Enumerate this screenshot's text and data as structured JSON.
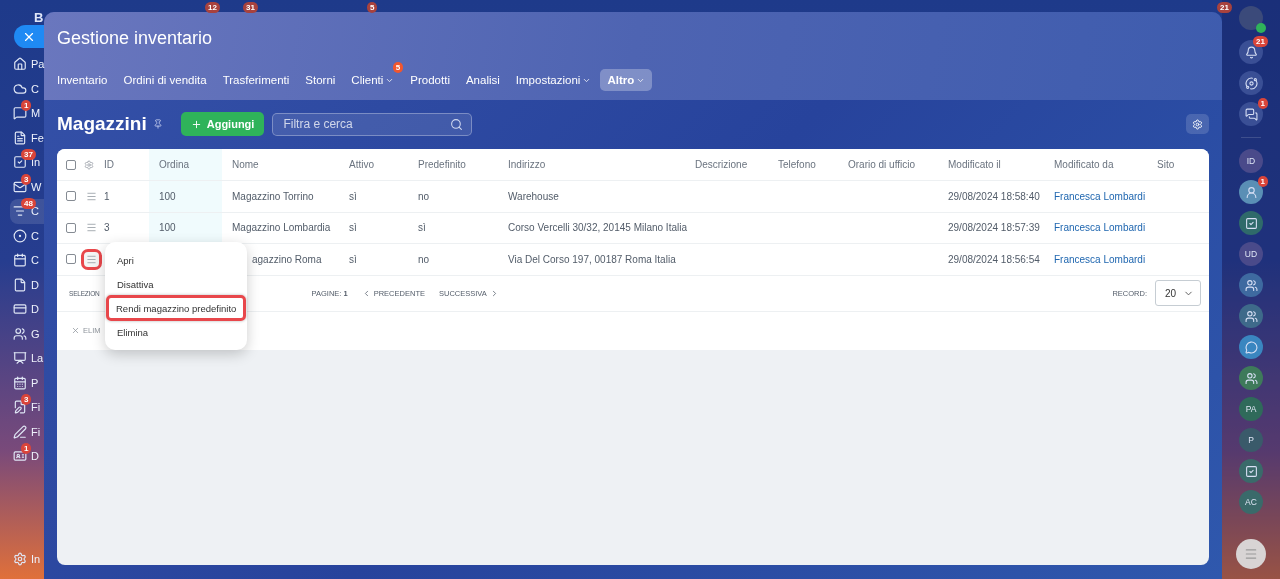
{
  "top_badges": [
    "12",
    "31",
    "5",
    "21"
  ],
  "left_sidebar": {
    "logo": "B",
    "items": [
      {
        "label": "Pa",
        "selected": false
      },
      {
        "label": "C",
        "selected": false
      },
      {
        "label": "M",
        "badge": "1",
        "selected": false
      },
      {
        "label": "Fe",
        "selected": false
      },
      {
        "label": "In",
        "badge": "37",
        "selected": false
      },
      {
        "label": "W",
        "badge": "3",
        "selected": false
      },
      {
        "label": "C",
        "badge": "48",
        "selected": true
      },
      {
        "label": "C",
        "selected": false
      },
      {
        "label": "C",
        "selected": false
      },
      {
        "label": "D",
        "selected": false
      },
      {
        "label": "D",
        "selected": false
      },
      {
        "label": "G",
        "selected": false
      },
      {
        "label": "La",
        "selected": false
      },
      {
        "label": "P",
        "selected": false
      },
      {
        "label": "Fi",
        "badge": "3",
        "selected": false
      },
      {
        "label": "Fi",
        "selected": false
      },
      {
        "label": "D",
        "badge": "1",
        "selected": false
      }
    ],
    "footer": "In"
  },
  "window": {
    "title": "Gestione inventario"
  },
  "tabs": [
    {
      "label": "Inventario",
      "selected": false,
      "dropdown": false
    },
    {
      "label": "Ordini di vendita",
      "selected": false,
      "dropdown": false
    },
    {
      "label": "Trasferimenti",
      "selected": false,
      "dropdown": false
    },
    {
      "label": "Storni",
      "selected": false,
      "dropdown": false
    },
    {
      "label": "Clienti",
      "selected": false,
      "dropdown": true,
      "badge": "5"
    },
    {
      "label": "Prodotti",
      "selected": false,
      "dropdown": false
    },
    {
      "label": "Analisi",
      "selected": false,
      "dropdown": false
    },
    {
      "label": "Impostazioni",
      "selected": false,
      "dropdown": true
    },
    {
      "label": "Altro",
      "selected": true,
      "dropdown": true
    }
  ],
  "page": {
    "title": "Magazzini",
    "add_button": "Aggiungi",
    "search": {
      "placeholder": "Filtra e cerca"
    }
  },
  "table": {
    "all_checked": false,
    "columns": [
      {
        "label": "ID",
        "sorted": false
      },
      {
        "label": "Ordina",
        "sorted": true
      },
      {
        "label": "Nome",
        "sorted": false
      },
      {
        "label": "Attivo",
        "sorted": false
      },
      {
        "label": "Predefinito",
        "sorted": false
      },
      {
        "label": "Indirizzo",
        "sorted": false
      },
      {
        "label": "Descrizione",
        "sorted": false
      },
      {
        "label": "Telefono",
        "sorted": false
      },
      {
        "label": "Orario di ufficio",
        "sorted": false
      },
      {
        "label": "Modificato il",
        "sorted": false
      },
      {
        "label": "Modificato da",
        "sorted": false
      },
      {
        "label": "Sito",
        "sorted": false
      }
    ],
    "rows": [
      {
        "checked": false,
        "menu_open": false,
        "id": "1",
        "ordina": "100",
        "nome": "Magazzino Torrino",
        "attivo": "sì",
        "predefinito": "no",
        "indirizzo": "Warehouse",
        "modificato_il": "29/08/2024 18:58:40",
        "modificato_da": "Francesca Lombardi"
      },
      {
        "checked": false,
        "menu_open": false,
        "id": "3",
        "ordina": "100",
        "nome": "Magazzino Lombardia",
        "attivo": "sì",
        "predefinito": "sì",
        "indirizzo": "Corso Vercelli 30/32, 20145 Milano Italia",
        "modificato_il": "29/08/2024 18:57:39",
        "modificato_da": "Francesca Lombardi"
      },
      {
        "checked": false,
        "menu_open": true,
        "nome": "agazzino Roma",
        "attivo": "sì",
        "predefinito": "no",
        "indirizzo": "Via Del Corso 197, 00187 Roma Italia",
        "modificato_il": "29/08/2024 18:56:54",
        "modificato_da": "Francesca Lombardi"
      }
    ],
    "context_menu": [
      {
        "label": "Apri",
        "highlighted": false
      },
      {
        "label": "Disattiva",
        "highlighted": false
      },
      {
        "label": "Rendi magazzino predefinito",
        "highlighted": true
      },
      {
        "label": "Elimina",
        "highlighted": false
      }
    ],
    "footer": {
      "select": "SELEZION",
      "pages_label": "PAGINE:",
      "page": "1",
      "prev": "PRECEDENTE",
      "next": "SUCCESSIVA",
      "record_label": "RECORD:",
      "record_value": "20"
    },
    "action": "ELIM"
  },
  "right_sidebar": [
    {
      "kind": "icon",
      "badge": "21"
    },
    {
      "kind": "icon"
    },
    {
      "kind": "icon",
      "badge": "1"
    },
    {
      "kind": "initials",
      "initials": "ID"
    },
    {
      "kind": "icon",
      "badge": "1"
    },
    {
      "kind": "icon"
    },
    {
      "kind": "initials",
      "initials": "UD"
    },
    {
      "kind": "icon"
    },
    {
      "kind": "icon"
    },
    {
      "kind": "icon"
    },
    {
      "kind": "icon"
    },
    {
      "kind": "initials",
      "initials": "PA"
    },
    {
      "kind": "initials",
      "initials": "P"
    },
    {
      "kind": "icon"
    },
    {
      "kind": "initials",
      "initials": "AC"
    }
  ]
}
